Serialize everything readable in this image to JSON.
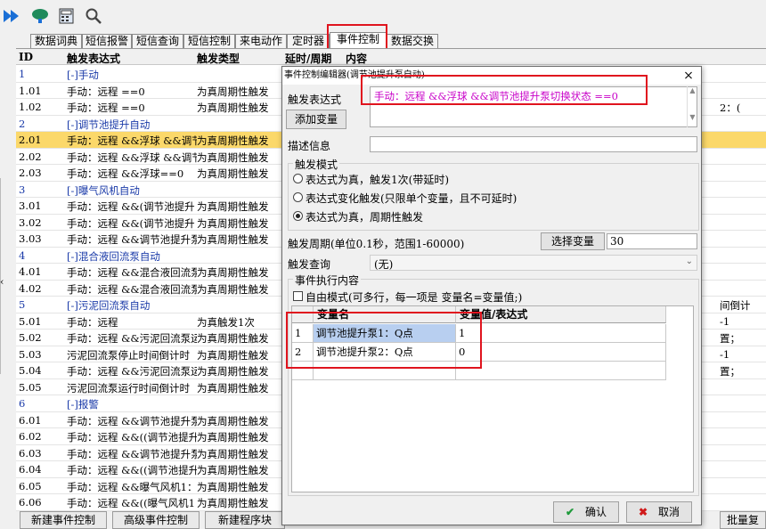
{
  "toolbar": {
    "icons": [
      "fast-forward-icon",
      "network-icon",
      "calculator-icon",
      "search-icon"
    ]
  },
  "tabs": [
    {
      "label": "数据词典"
    },
    {
      "label": "短信报警"
    },
    {
      "label": "短信查询"
    },
    {
      "label": "短信控制"
    },
    {
      "label": "来电动作"
    },
    {
      "label": "定时器"
    },
    {
      "label": "事件控制",
      "active": true
    },
    {
      "label": "数据交换"
    }
  ],
  "grid": {
    "columns": {
      "id": "ID",
      "expr": "触发表达式",
      "type": "触发类型",
      "delay": "延时/周期",
      "content": "内容"
    },
    "rows": [
      {
        "id": "1",
        "expr": "[-]手动",
        "type": "",
        "kind": "group"
      },
      {
        "id": "1.01",
        "expr": "手动：远程 ==0",
        "type": "为真周期性触发"
      },
      {
        "id": "1.02",
        "expr": "手动：远程 ==0",
        "type": "为真周期性触发"
      },
      {
        "id": "2",
        "expr": "[-]调节池提升自动",
        "type": "",
        "kind": "group"
      },
      {
        "id": "2.01",
        "expr": "手动：远程 &&浮球 &&调节",
        "type": "为真周期性触发",
        "kind": "selected"
      },
      {
        "id": "2.02",
        "expr": "手动：远程 &&浮球 &&调节",
        "type": "为真周期性触发"
      },
      {
        "id": "2.03",
        "expr": "手动：远程 &&浮球==0",
        "type": "为真周期性触发"
      },
      {
        "id": "3",
        "expr": "[-]曝气风机自动",
        "type": "",
        "kind": "group"
      },
      {
        "id": "3.01",
        "expr": "手动：远程 &&(调节池提升",
        "type": "为真周期性触发"
      },
      {
        "id": "3.02",
        "expr": "手动：远程 &&(调节池提升",
        "type": "为真周期性触发"
      },
      {
        "id": "3.03",
        "expr": "手动：远程 &&调节池提升泵",
        "type": "为真周期性触发"
      },
      {
        "id": "4",
        "expr": "[-]混合液回流泵自动",
        "type": "",
        "kind": "group"
      },
      {
        "id": "4.01",
        "expr": "手动：远程 &&混合液回流泵",
        "type": "为真周期性触发"
      },
      {
        "id": "4.02",
        "expr": "手动：远程 &&混合液回流泵",
        "type": "为真周期性触发"
      },
      {
        "id": "5",
        "expr": "[-]污泥回流泵自动",
        "type": "",
        "kind": "group"
      },
      {
        "id": "5.01",
        "expr": "手动：远程",
        "type": "为真触发1次"
      },
      {
        "id": "5.02",
        "expr": "手动：远程 &&污泥回流泵运",
        "type": "为真周期性触发"
      },
      {
        "id": "5.03",
        "expr": "污泥回流泵停止时间倒计时",
        "type": "为真周期性触发"
      },
      {
        "id": "5.04",
        "expr": "手动：远程 &&污泥回流泵运",
        "type": "为真周期性触发"
      },
      {
        "id": "5.05",
        "expr": "污泥回流泵运行时间倒计时",
        "type": "为真周期性触发"
      },
      {
        "id": "6",
        "expr": "[-]报警",
        "type": "",
        "kind": "group"
      },
      {
        "id": "6.01",
        "expr": "手动：远程 &&调节池提升泵",
        "type": "为真周期性触发"
      },
      {
        "id": "6.02",
        "expr": "手动：远程 &&((调节池提升",
        "type": "为真周期性触发"
      },
      {
        "id": "6.03",
        "expr": "手动：远程 &&调节池提升泵",
        "type": "为真周期性触发"
      },
      {
        "id": "6.04",
        "expr": "手动：远程 &&((调节池提升",
        "type": "为真周期性触发"
      },
      {
        "id": "6.05",
        "expr": "手动：远程 &&曝气风机1：",
        "type": "为真周期性触发"
      },
      {
        "id": "6.06",
        "expr": "手动：远程 &&((曝气风机1",
        "type": "为真周期性触发"
      }
    ],
    "right_fragments": [
      "2：(",
      "间倒计",
      "-1",
      "置；",
      "-1",
      "置；"
    ]
  },
  "bottom_buttons": [
    "新建事件控制",
    "高级事件控制",
    "新建程序块",
    "批量复"
  ],
  "dialog": {
    "title": "事件控制编辑器(调节池提升泵自动)",
    "close": "×",
    "expr_label": "触发表达式",
    "expr_value": "手动：远程 &&浮球 &&调节池提升泵切换状态 ==0",
    "add_var": "添加变量",
    "desc_label": "描述信息",
    "desc_value": "",
    "mode_group": "触发模式",
    "mode_options": [
      {
        "label": "表达式为真，触发1次(带延时)",
        "selected": false
      },
      {
        "label": "表达式变化触发(只限单个变量，且不可延时)",
        "selected": false
      },
      {
        "label": "表达式为真，周期性触发",
        "selected": true
      }
    ],
    "period_label": "触发周期(单位0.1秒，范围1-60000)",
    "select_var": "选择变量",
    "period_value": "30",
    "query_label": "触发查询",
    "query_value": "(无)",
    "exec_group": "事件执行内容",
    "free_mode": "自由模式(可多行，每一项是 变量名=变量值;)",
    "var_table": {
      "headers": [
        "变量名",
        "变量值/表达式"
      ],
      "rows": [
        {
          "n": "1",
          "name": "调节池提升泵1：Q点",
          "value": "1"
        },
        {
          "n": "2",
          "name": "调节池提升泵2：Q点",
          "value": "0"
        }
      ]
    },
    "ok": "确认",
    "cancel": "取消"
  }
}
